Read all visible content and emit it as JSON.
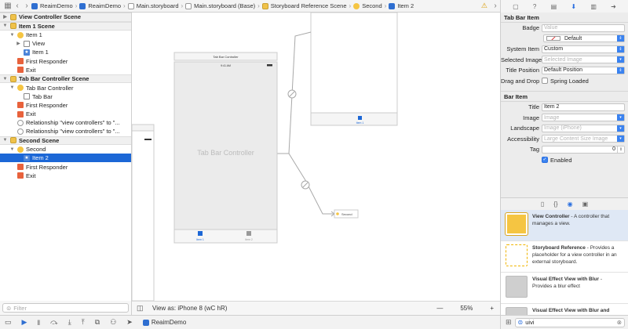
{
  "breadcrumbs": [
    "ReaimDemo",
    "ReaimDemo",
    "Main.storyboard",
    "Main.storyboard (Base)",
    "Storyboard Reference Scene",
    "Second",
    "Item 2"
  ],
  "outline": {
    "sections": [
      {
        "title": "View Controller Scene",
        "rows": []
      },
      {
        "title": "Item 1 Scene",
        "rows": [
          {
            "label": "Item 1",
            "icon": "vc",
            "indent": 1
          },
          {
            "label": "View",
            "icon": "view",
            "indent": 2
          },
          {
            "label": "Item 1",
            "icon": "star",
            "indent": 2
          },
          {
            "label": "First Responder",
            "icon": "fr",
            "indent": 1
          },
          {
            "label": "Exit",
            "icon": "ex",
            "indent": 1
          }
        ]
      },
      {
        "title": "Tab Bar Controller Scene",
        "rows": [
          {
            "label": "Tab Bar Controller",
            "icon": "vc",
            "indent": 1
          },
          {
            "label": "Tab Bar",
            "icon": "view",
            "indent": 2
          },
          {
            "label": "First Responder",
            "icon": "fr",
            "indent": 1
          },
          {
            "label": "Exit",
            "icon": "ex",
            "indent": 1
          },
          {
            "label": "Relationship \"view controllers\" to \"...",
            "icon": "rel",
            "indent": 1
          },
          {
            "label": "Relationship \"view controllers\" to \"...",
            "icon": "rel",
            "indent": 1
          }
        ]
      },
      {
        "title": "Second Scene",
        "rows": [
          {
            "label": "Second",
            "icon": "vc",
            "indent": 1
          },
          {
            "label": "Item 2",
            "icon": "star",
            "indent": 2,
            "selected": true
          },
          {
            "label": "First Responder",
            "icon": "fr",
            "indent": 1
          },
          {
            "label": "Exit",
            "icon": "ex",
            "indent": 1
          }
        ]
      }
    ],
    "filter_placeholder": "Filter"
  },
  "canvas": {
    "tbc_title": "Tab Bar Controller",
    "tbc_center": "Tab Bar Controller",
    "tbc_time": "9:41 AM",
    "tab_item1": "Item 1",
    "tab_item2": "Item 2",
    "top_vc_tab": "Item 1",
    "second_ref": "Second",
    "view_as": "View as: iPhone 8 (wC hR)",
    "zoom": "55%",
    "zoom_minus": "—",
    "zoom_plus": "+"
  },
  "status": {
    "project": "ReaimDemo"
  },
  "inspector": {
    "tab_bar_item": {
      "heading": "Tab Bar Item",
      "badge_label": "Badge",
      "badge_placeholder": "Value",
      "badge_color": "Default",
      "system_item_label": "System Item",
      "system_item_value": "Custom",
      "selected_image_label": "Selected Image",
      "selected_image_placeholder": "Selected Image",
      "title_position_label": "Title Position",
      "title_position_value": "Default Position",
      "drag_drop_label": "Drag and Drop",
      "spring_loaded": "Spring Loaded"
    },
    "bar_item": {
      "heading": "Bar Item",
      "title_label": "Title",
      "title_value": "Item 2",
      "image_label": "Image",
      "image_placeholder": "Image",
      "landscape_label": "Landscape",
      "landscape_placeholder": "Image (iPhone)",
      "accessibility_label": "Accessibility",
      "accessibility_placeholder": "Large Content Size Image",
      "tag_label": "Tag",
      "tag_value": "0",
      "enabled": "Enabled"
    }
  },
  "library": {
    "items": [
      {
        "title": "View Controller",
        "desc": " - A controller that manages a view.",
        "selected": true
      },
      {
        "title": "Storyboard Reference",
        "desc": " - Provides a placeholder for a view controller in an external storyboard."
      },
      {
        "title": "Visual Effect View with Blur",
        "desc": " - Provides a blur effect"
      },
      {
        "title": "Visual Effect View with Blur and",
        "desc": ""
      }
    ],
    "search_value": "uivi"
  },
  "colors": {
    "accent": "#1c67d6",
    "selection": "#1c67d6",
    "vc_yellow": "#f5c542"
  }
}
